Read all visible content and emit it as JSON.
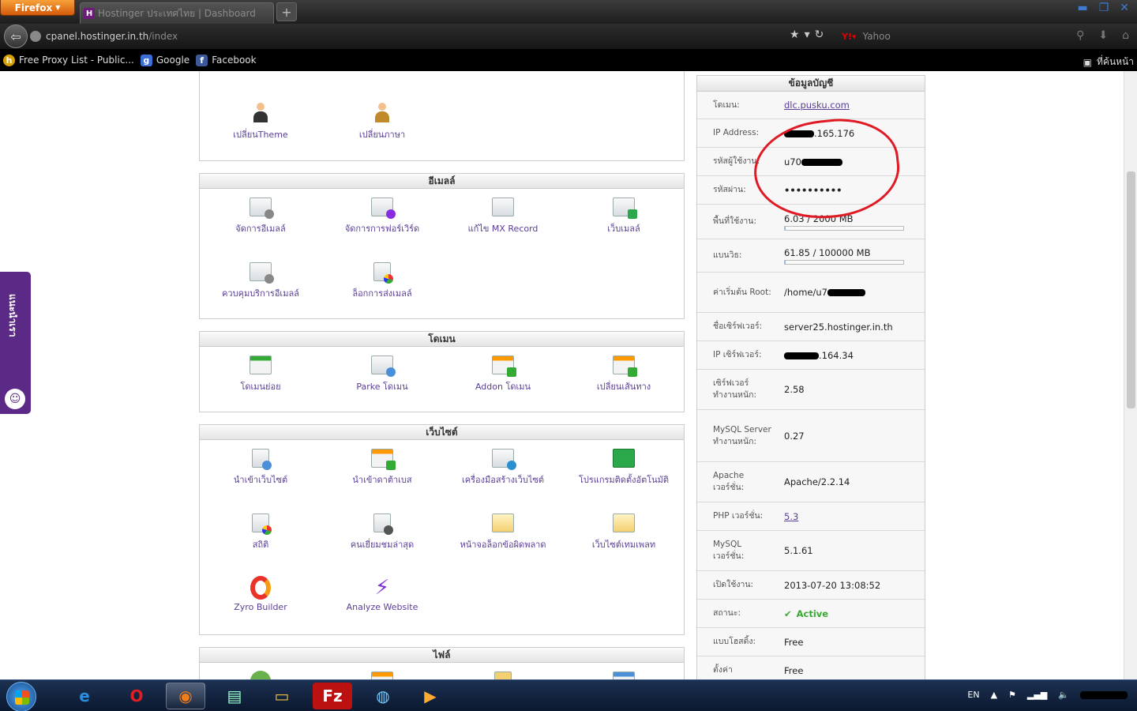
{
  "browser": {
    "app_button": "Firefox",
    "tab_title": "Hostinger ประเทศไทย | Dashboard",
    "url_domain": "cpanel.hostinger.in.th",
    "url_path": "/index",
    "search_engine": "Yahoo",
    "bookmarks": [
      "Free Proxy List - Public...",
      "Google",
      "Facebook"
    ],
    "bookmarks_home": "ที่ค้นหน้า"
  },
  "sections": {
    "top": {
      "items": [
        "เปลี่ยนTheme",
        "เปลี่ยนภาษา"
      ]
    },
    "email": {
      "title": "อีเมลล์",
      "items": [
        "จัดการอีเมลล์",
        "จัดการการฟอร์เวิร์ด",
        "แก้ไข MX Record",
        "เว็บเมลล์",
        "ควบคุมบริการอีเมลล์",
        "ล็อกการส่งเมลล์"
      ]
    },
    "domain": {
      "title": "โดเมน",
      "items": [
        "โดเมนย่อย",
        "Parke โดเมน",
        "Addon โดเมน",
        "เปลี่ยนเส้นทาง"
      ]
    },
    "website": {
      "title": "เว็บไซต์",
      "items": [
        "นำเข้าเว็บไซต์",
        "นำเข้าดาต้าเบส",
        "เครื่องมือสร้างเว็บไซต์",
        "โปรแกรมติดตั้งอัตโนมัติ",
        "สถิติ",
        "คนเยี่ยมชมล่าสุด",
        "หน้าจอล็อกข้อผิดพลาด",
        "เว็บไซต์เทมเพลท",
        "Zyro Builder",
        "Analyze Website"
      ]
    },
    "files": {
      "title": "ไฟล์"
    }
  },
  "account": {
    "title": "ข้อมูลบัญชี",
    "rows": {
      "domain": {
        "label": "โดเมน:",
        "value": "dlc.pusku.com"
      },
      "ip": {
        "label": "IP Address:",
        "value": ".165.176"
      },
      "user": {
        "label": "รหัสผู้ใช้งาน:",
        "value": "u70"
      },
      "password": {
        "label": "รหัสผ่าน:",
        "value": "••••••••••"
      },
      "disk": {
        "label": "พื้นที่ใช้งาน:",
        "value": "6.03 / 2000 MB",
        "used_fraction": 0.003
      },
      "bandwidth": {
        "label": "แบนวิธ:",
        "value": "61.85 / 100000 MB",
        "used_fraction": 0.0006
      },
      "root": {
        "label": "ค่าเริ่มต้น Root:",
        "value": "/home/u7"
      },
      "server": {
        "label": "ชื่อเซิร์ฟเวอร์:",
        "value": "server25.hostinger.in.th"
      },
      "server_ip": {
        "label": "IP เซิร์ฟเวอร์:",
        "value": ".164.34"
      },
      "load": {
        "label": "เซิร์ฟเวอร์ทำงานหนัก:",
        "value": "2.58"
      },
      "mysql_load": {
        "label": "MySQL Server ทำงานหนัก:",
        "value": "0.27"
      },
      "apache": {
        "label": "Apache เวอร์ชั่น:",
        "value": "Apache/2.2.14"
      },
      "php": {
        "label": "PHP เวอร์ชั่น:",
        "value": "5.3"
      },
      "mysql": {
        "label": "MySQL เวอร์ชั่น:",
        "value": "5.1.61"
      },
      "created": {
        "label": "เปิดใช้งาน:",
        "value": "2013-07-20 13:08:52"
      },
      "status": {
        "label": "สถานะ:",
        "value": "Active"
      },
      "plan": {
        "label": "แบบโฮสติ้ง:",
        "value": "Free"
      },
      "settings": {
        "label": "ตั้งค่า",
        "value": "Free"
      }
    }
  },
  "feedback_tab": "แนะนำเรา",
  "taskbar": {
    "language": "EN"
  },
  "colors": {
    "link": "#5a3e96",
    "status_active": "#3aa832",
    "annotation": "#e01a24",
    "feedback_tab": "#5b2a86"
  }
}
